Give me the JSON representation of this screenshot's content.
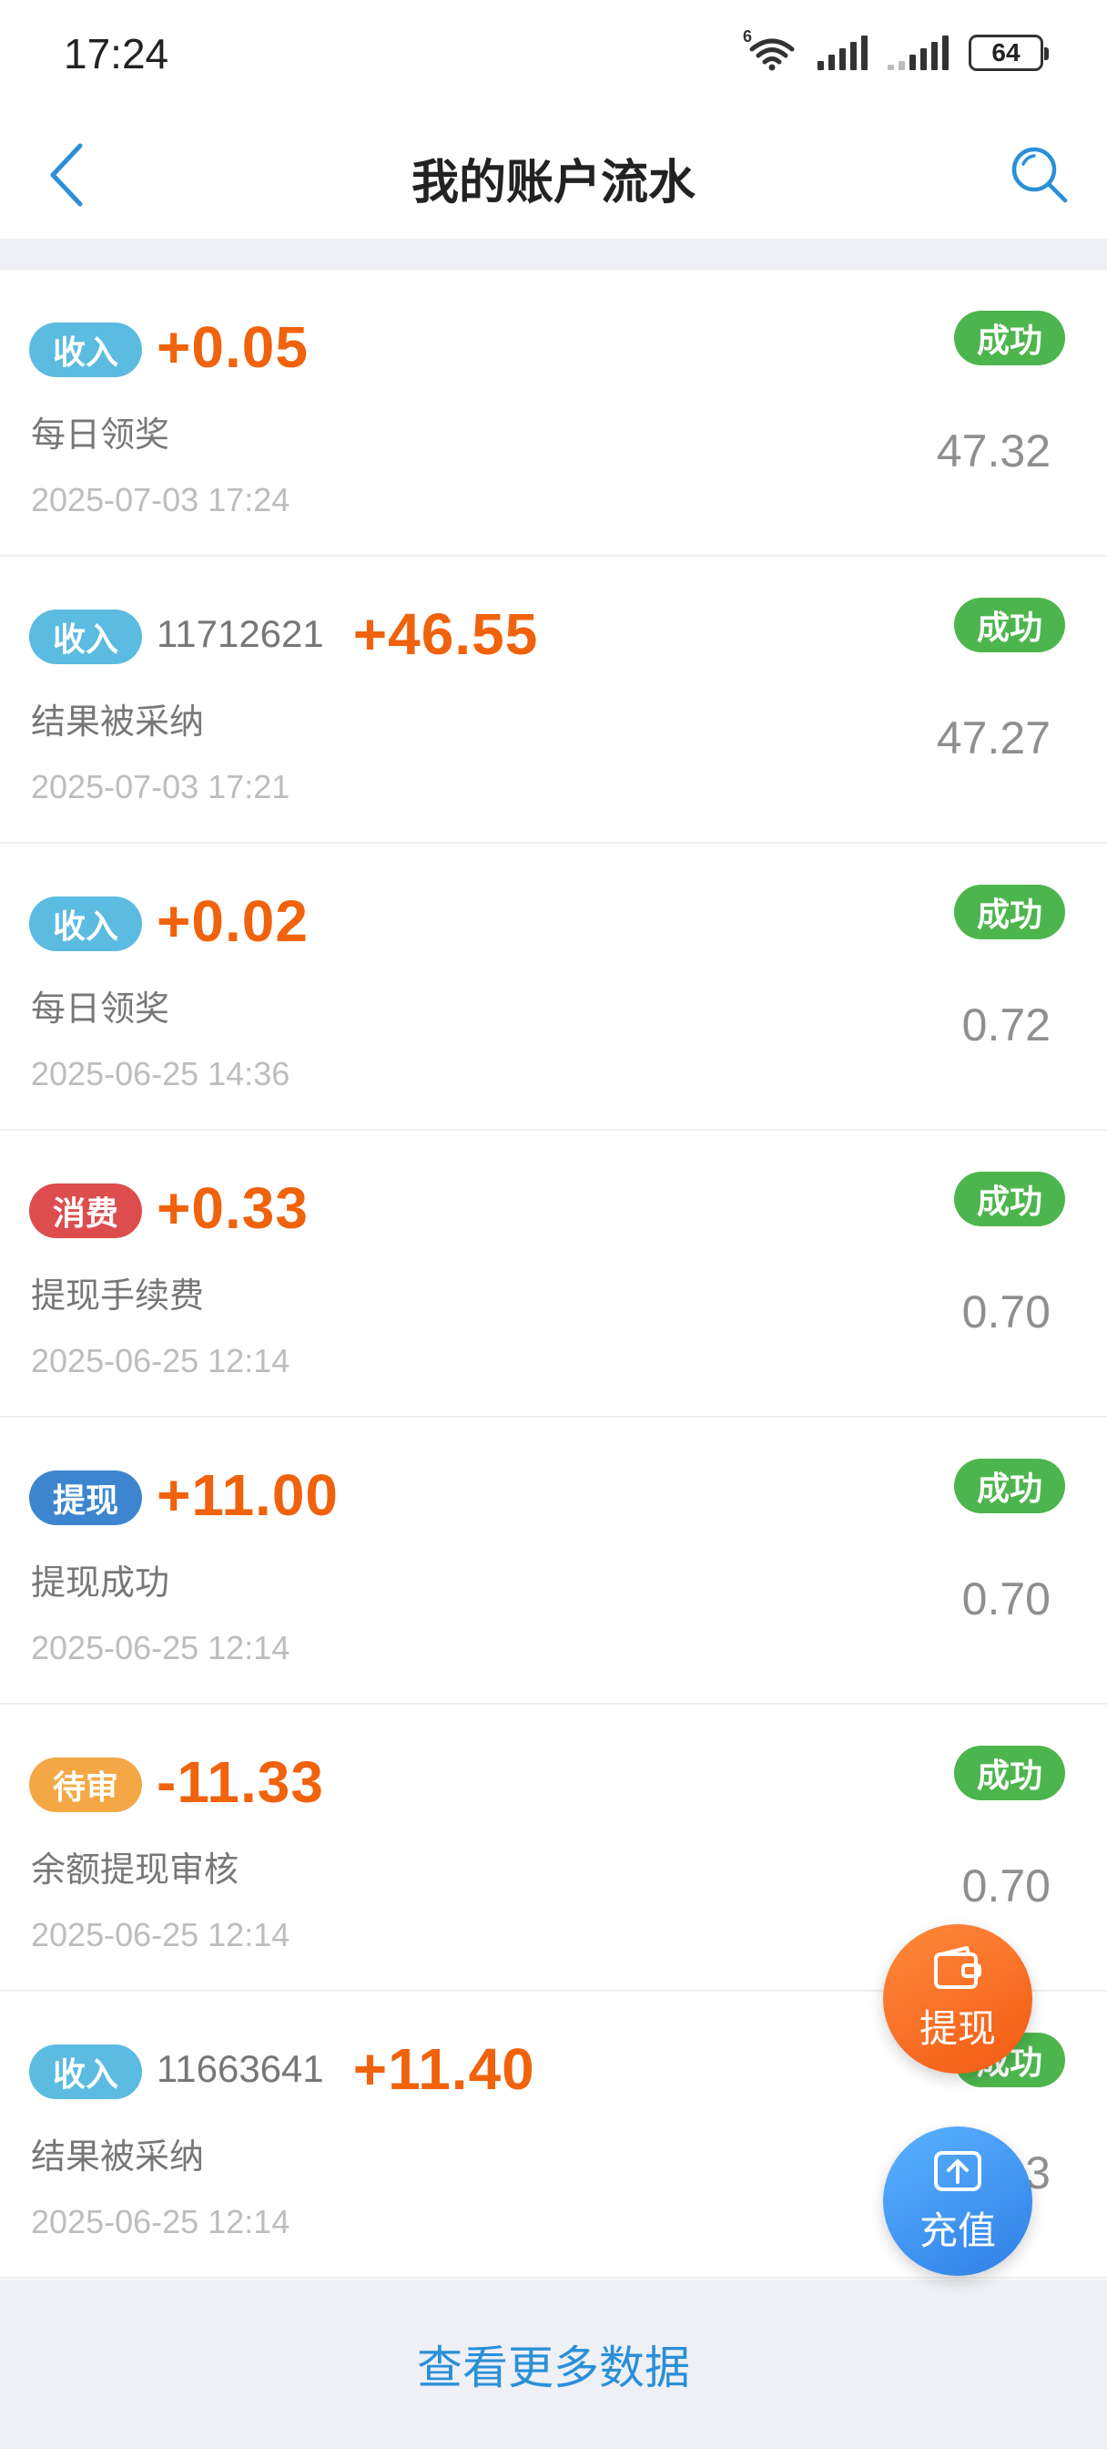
{
  "status_bar": {
    "time": "17:24",
    "wifi_label": "6",
    "battery": "64"
  },
  "nav": {
    "title": "我的账户流水"
  },
  "colors": {
    "income": "#5bbbe0",
    "consume": "#dd4d4d",
    "withdraw": "#3d86cf",
    "pending": "#f3a845",
    "success": "#4db54d",
    "amount": "#f0620c"
  },
  "transactions": [
    {
      "type": "收入",
      "order_no": "",
      "amount": "+0.05",
      "desc": "每日领奖",
      "date": "2025-07-03 17:24",
      "status": "成功",
      "balance": "47.32"
    },
    {
      "type": "收入",
      "order_no": "11712621",
      "amount": "+46.55",
      "desc": "结果被采纳",
      "date": "2025-07-03 17:21",
      "status": "成功",
      "balance": "47.27"
    },
    {
      "type": "收入",
      "order_no": "",
      "amount": "+0.02",
      "desc": "每日领奖",
      "date": "2025-06-25 14:36",
      "status": "成功",
      "balance": "0.72"
    },
    {
      "type": "消费",
      "order_no": "",
      "amount": "+0.33",
      "desc": "提现手续费",
      "date": "2025-06-25 12:14",
      "status": "成功",
      "balance": "0.70"
    },
    {
      "type": "提现",
      "order_no": "",
      "amount": "+11.00",
      "desc": "提现成功",
      "date": "2025-06-25 12:14",
      "status": "成功",
      "balance": "0.70"
    },
    {
      "type": "待审",
      "order_no": "",
      "amount": "-11.33",
      "desc": "余额提现审核",
      "date": "2025-06-25 12:14",
      "status": "成功",
      "balance": "0.70"
    },
    {
      "type": "收入",
      "order_no": "11663641",
      "amount": "+11.40",
      "desc": "结果被采纳",
      "date": "2025-06-25 12:14",
      "status": "成功",
      "balance": "0.3"
    }
  ],
  "fab": {
    "withdraw_label": "提现",
    "recharge_label": "充值"
  },
  "footer": {
    "more_label": "查看更多数据"
  }
}
